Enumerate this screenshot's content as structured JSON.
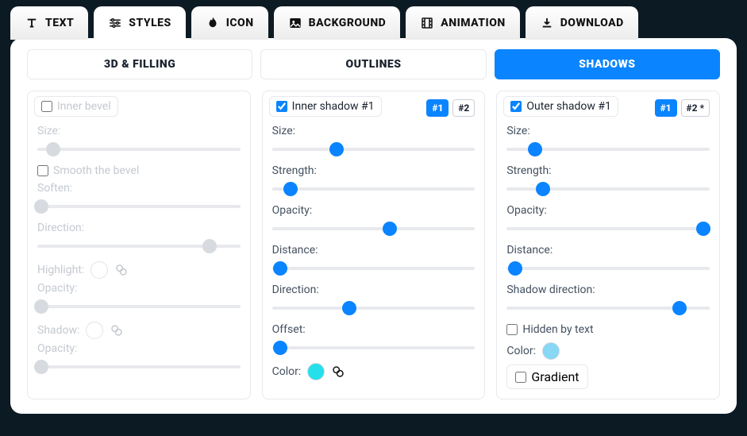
{
  "tabs": {
    "text": "TEXT",
    "styles": "STYLES",
    "icon": "ICON",
    "background": "BACKGROUND",
    "animation": "ANIMATION",
    "download": "DOWNLOAD",
    "active": "styles"
  },
  "subtabs": {
    "a": "3D & FILLING",
    "b": "OUTLINES",
    "c": "SHADOWS",
    "active": "c"
  },
  "cards": {
    "bevel": {
      "title": "Inner bevel",
      "checked": false,
      "size_label": "Size:",
      "smooth_label": "Smooth the bevel",
      "soften_label": "Soften:",
      "direction_label": "Direction:",
      "highlight_label": "Highlight:",
      "opacity_label": "Opacity:",
      "shadow_label": "Shadow:",
      "opacity2_label": "Opacity:",
      "swatch_highlight_color": "#ffffff",
      "swatch_shadow_color": "#c0c5cc",
      "slider_pos": {
        "size": 8,
        "soften": 2,
        "direction": 85,
        "opacity1": 2,
        "opacity2": 2
      }
    },
    "inner": {
      "title": "Inner shadow #1",
      "checked": true,
      "chips": {
        "c1": "#1",
        "c2": "#2",
        "active": "c1"
      },
      "size_label": "Size:",
      "strength_label": "Strength:",
      "opacity_label": "Opacity:",
      "distance_label": "Distance:",
      "direction_label": "Direction:",
      "offset_label": "Offset:",
      "color_label": "Color:",
      "swatch_color": "#25e0ea",
      "slider_pos": {
        "size": 32,
        "strength": 9,
        "opacity": 58,
        "distance": 4,
        "direction": 38,
        "offset": 4
      }
    },
    "outer": {
      "title": "Outer shadow #1",
      "checked": true,
      "chips": {
        "c1": "#1",
        "c2": "#2 *",
        "active": "c1"
      },
      "size_label": "Size:",
      "strength_label": "Strength:",
      "opacity_label": "Opacity:",
      "distance_label": "Distance:",
      "direction_label": "Shadow direction:",
      "hidden_label": "Hidden by text",
      "hidden_checked": false,
      "color_label": "Color:",
      "swatch_color": "#87d7f5",
      "gradient_label": "Gradient",
      "gradient_checked": false,
      "slider_pos": {
        "size": 14,
        "strength": 18,
        "opacity": 97,
        "distance": 4,
        "direction": 85
      }
    }
  }
}
